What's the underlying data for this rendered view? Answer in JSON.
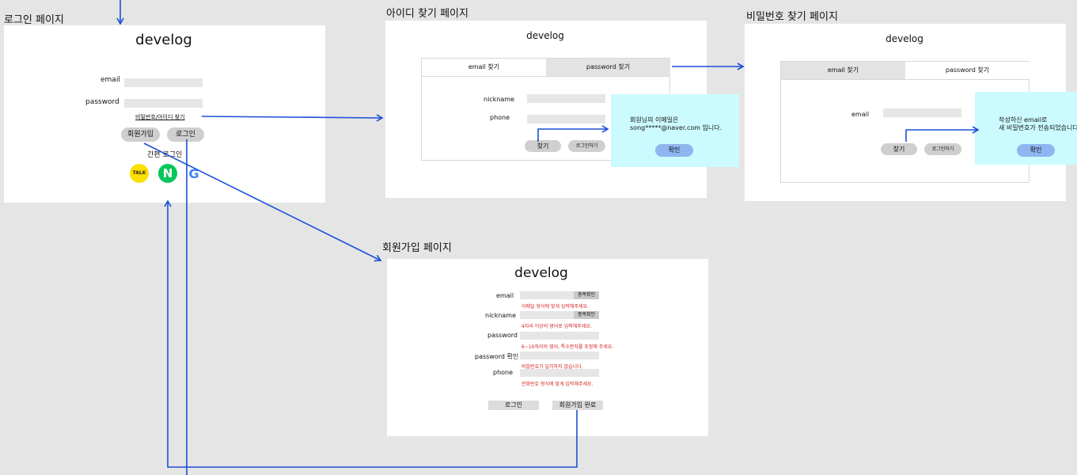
{
  "login_page": {
    "label": "로그인 페이지",
    "brand": "develog",
    "email_label": "email",
    "password_label": "password",
    "find_link": "비밀번호/아이디 찾기",
    "signup_button": "회원가입",
    "login_button": "로그인",
    "easy_login": "간편 로그인",
    "social": [
      {
        "name": "kakao-talk-icon",
        "text": "TALK",
        "color": "#fae100"
      },
      {
        "name": "naver-icon",
        "text": "N",
        "color": "#03c75a"
      },
      {
        "name": "google-icon",
        "text": "G",
        "color": "#4285f4"
      }
    ]
  },
  "find_id_page": {
    "label": "아이디 찾기 페이지",
    "brand": "develog",
    "tabs": [
      {
        "label": "email 찾기",
        "active": true
      },
      {
        "label": "password 찾기",
        "active": false
      }
    ],
    "nickname_label": "nickname",
    "phone_label": "phone",
    "find_button": "찾기",
    "login_button": "로그인하기",
    "popup": {
      "line1": "회원님의 이메일은",
      "line2": "song*****@naver.com 입니다.",
      "confirm": "확인"
    }
  },
  "find_pw_page": {
    "label": "비밀번호 찾기 페이지",
    "brand": "develog",
    "tabs": [
      {
        "label": "email 찾기",
        "active": false
      },
      {
        "label": "password 찾기",
        "active": true
      }
    ],
    "email_label": "email",
    "find_button": "찾기",
    "login_button": "로그인하기",
    "popup": {
      "line1": "작성하신 email로",
      "line2": "새 비밀번호가 전송되었습니다.",
      "confirm": "확인"
    }
  },
  "signup_page": {
    "label": "회원가입 페이지",
    "brand": "develog",
    "fields": [
      {
        "label": "email",
        "error": "이메일 형식에 맞게 입력해주세요.",
        "dup_button": "중복확인"
      },
      {
        "label": "nickname",
        "error": "4자리 이상의 영어로 입력해주세요.",
        "dup_button": "중복확인"
      },
      {
        "label": "password",
        "error": "6~10자리의 영어, 특수문자를 포함해 주세요.",
        "dup_button": ""
      },
      {
        "label": "password 확인",
        "error": "비밀번호가 일치하지 않습니다.",
        "dup_button": ""
      },
      {
        "label": "phone",
        "error": "전화번호 형식에 맞게 입력해주세요.",
        "dup_button": ""
      }
    ],
    "login_button": "로그인",
    "complete_button": "회원가입 완료"
  },
  "colors": {
    "background": "#e5e5e5",
    "arrow": "#1a4fd8",
    "popup": "#ccfbff",
    "confirm": "#8fb6f0",
    "error": "#d21f1f"
  }
}
